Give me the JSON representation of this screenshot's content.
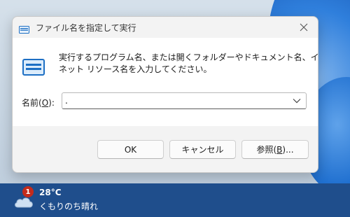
{
  "dialog": {
    "title": "ファイル名を指定して実行",
    "description_line1": "実行するプログラム名、または開くフォルダーやドキュメント名、インター",
    "description_line2": "ネット リソース名を入力してください。",
    "field": {
      "label_prefix": "名前(",
      "label_accel": "O",
      "label_suffix": "):",
      "value": "."
    },
    "buttons": {
      "ok": "OK",
      "cancel": "キャンセル",
      "browse_prefix": "参照(",
      "browse_accel": "B",
      "browse_suffix": ")..."
    },
    "icons": {
      "title": "run-icon",
      "main": "run-icon",
      "close": "close-icon",
      "dropdown": "chevron-down-icon"
    }
  },
  "taskbar": {
    "weather": {
      "badge": "1",
      "temperature": "28°C",
      "condition": "くもりのち晴れ",
      "icon": "cloudy-icon"
    }
  },
  "colors": {
    "taskbar": "#1f4e8c",
    "badge": "#c42b1c",
    "run_icon": "#1d6fc4"
  }
}
